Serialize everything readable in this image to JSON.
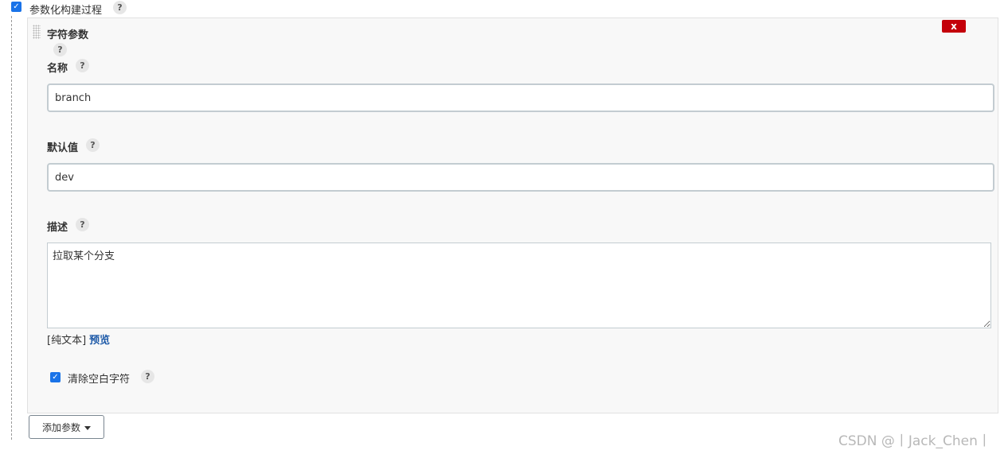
{
  "parameterized": {
    "checked": true,
    "label": "参数化构建过程",
    "help": "?"
  },
  "section": {
    "title": "字符参数",
    "help": "?",
    "delete_label": "x"
  },
  "fields": {
    "name": {
      "label": "名称",
      "help": "?",
      "value": "branch"
    },
    "default": {
      "label": "默认值",
      "help": "?",
      "value": "dev"
    },
    "description": {
      "label": "描述",
      "help": "?",
      "value": "拉取某个分支"
    }
  },
  "format": {
    "plain": "[纯文本]",
    "preview": "预览"
  },
  "trim": {
    "checked": true,
    "label": "清除空白字符",
    "help": "?"
  },
  "add_param": {
    "label": "添加参数"
  },
  "watermark": "CSDN @丨Jack_Chen丨"
}
